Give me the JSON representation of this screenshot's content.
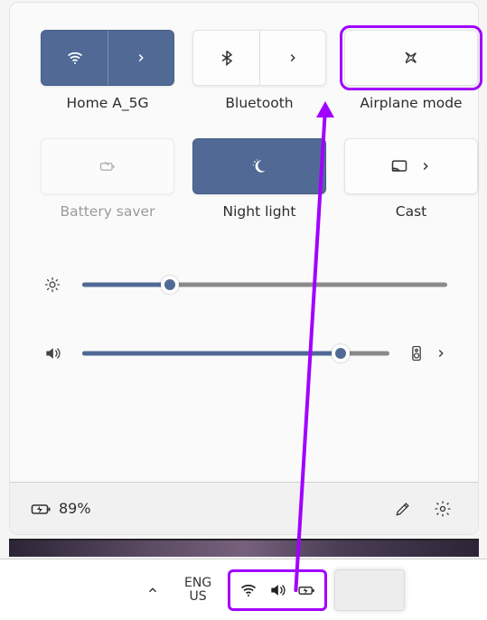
{
  "panel": {
    "tiles": {
      "wifi": {
        "label": "Home A_5G",
        "active": true,
        "expandable": true
      },
      "bluetooth": {
        "label": "Bluetooth",
        "active": false,
        "expandable": true
      },
      "airplane": {
        "label": "Airplane mode",
        "active": false,
        "expandable": false
      },
      "battery_saver": {
        "label": "Battery saver",
        "active": false,
        "disabled": true,
        "expandable": false
      },
      "night_light": {
        "label": "Night light",
        "active": true,
        "expandable": false
      },
      "cast": {
        "label": "Cast",
        "active": false,
        "expandable": true
      }
    },
    "sliders": {
      "brightness": {
        "value": 24,
        "min": 0,
        "max": 100
      },
      "volume": {
        "value": 84,
        "min": 0,
        "max": 100
      }
    },
    "footer": {
      "battery_percent": "89%"
    }
  },
  "taskbar": {
    "language": {
      "line1": "ENG",
      "line2": "US"
    }
  },
  "colors": {
    "accent": "#506a95",
    "highlight": "#a100ff"
  }
}
